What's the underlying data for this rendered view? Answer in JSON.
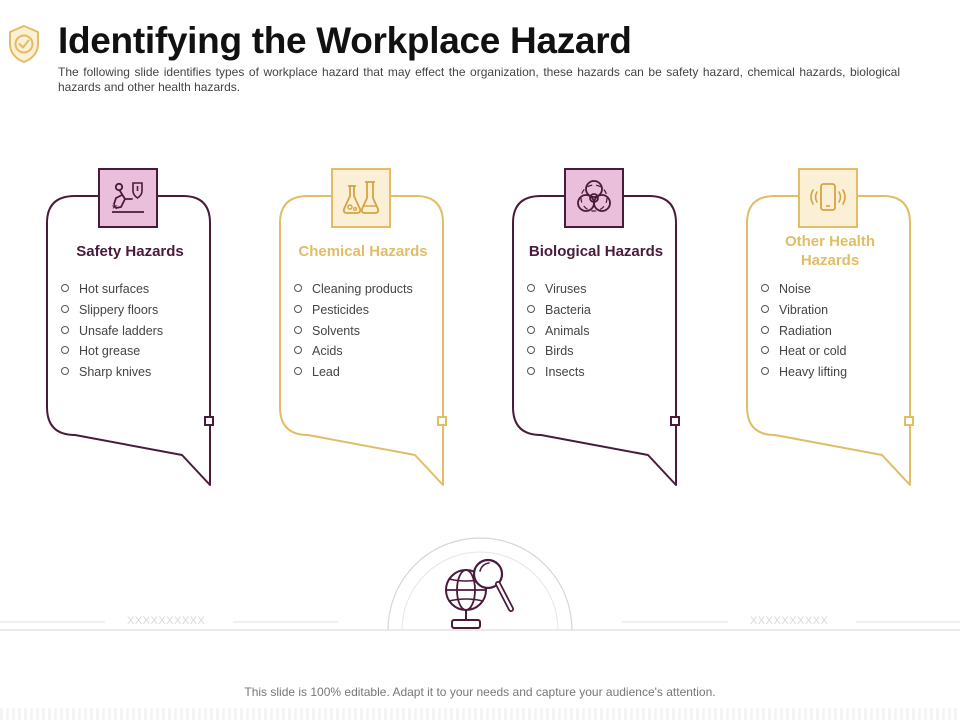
{
  "header": {
    "title": "Identifying the Workplace Hazard",
    "subtitle": "The following slide identifies types of workplace hazard that may effect the organization, these hazards can be safety hazard, chemical hazards, biological hazards and other health hazards.",
    "icon": "shield-check-icon"
  },
  "colors": {
    "dark": "#4a1a3a",
    "gold": "#e1bd65",
    "dark_fill": "#e9bfdc",
    "gold_fill": "#fbefd6"
  },
  "cards": [
    {
      "title": "Safety Hazards",
      "icon": "slippery-floor-icon",
      "items": [
        "Hot surfaces",
        "Slippery floors",
        "Unsafe ladders",
        "Hot grease",
        "Sharp knives"
      ]
    },
    {
      "title": "Chemical Hazards",
      "icon": "chemical-flasks-icon",
      "items": [
        "Cleaning products",
        "Pesticides",
        "Solvents",
        "Acids",
        "Lead"
      ]
    },
    {
      "title": "Biological Hazards",
      "icon": "biohazard-icon",
      "items": [
        "Viruses",
        "Bacteria",
        "Animals",
        "Birds",
        "Insects"
      ]
    },
    {
      "title": "Other Health Hazards",
      "icon": "vibrating-phone-icon",
      "items": [
        "Noise",
        "Vibration",
        "Radiation",
        "Heat or cold",
        "Heavy lifting"
      ]
    }
  ],
  "placeholders": {
    "left": "XXXXXXXXXX",
    "right": "XXXXXXXXXX"
  },
  "center_icon": "globe-magnifier-icon",
  "footer": {
    "note": "This slide is 100% editable. Adapt it to your needs and capture your audience's attention."
  }
}
